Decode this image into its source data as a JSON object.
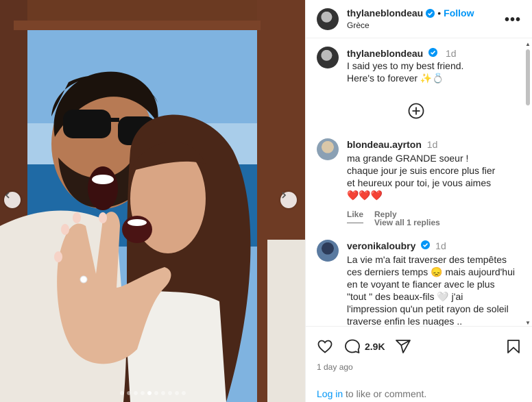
{
  "post": {
    "username": "thylaneblondeau",
    "follow_label": "Follow",
    "location": "Grèce",
    "separator": "•"
  },
  "caption": {
    "username": "thylaneblondeau",
    "time": "1d",
    "line1": "I said yes to my best friend.",
    "line2": "Here's to forever ✨💍"
  },
  "comments": [
    {
      "username": "blondeau.ayrton",
      "time": "1d",
      "text": "ma grande GRANDE soeur ! chaque jour je suis encore plus fier et heureux pour toi, je vous aimes ❤️❤️❤️",
      "like_label": "Like",
      "reply_label": "Reply"
    },
    {
      "username": "veronikaloubry",
      "time": "1d",
      "text": "La vie m'a fait traverser des tempêtes ces derniers temps 😞 mais aujourd'hui en te voyant te fiancer avec le plus \"tout \" des beaux-fils 🤍 j'ai l'impression qu'un petit rayon de soleil traverse enfin les nuages .."
    }
  ],
  "view_replies": "View all 1 replies",
  "footer": {
    "comment_count": "2.9K",
    "time_ago": "1 day ago",
    "login_link": "Log in",
    "login_text": " to like or comment."
  },
  "carousel": {
    "slides": 10,
    "active_index": 4
  },
  "colors": {
    "link": "#0095f6",
    "heart": "#e8112d",
    "muted": "#737373"
  }
}
